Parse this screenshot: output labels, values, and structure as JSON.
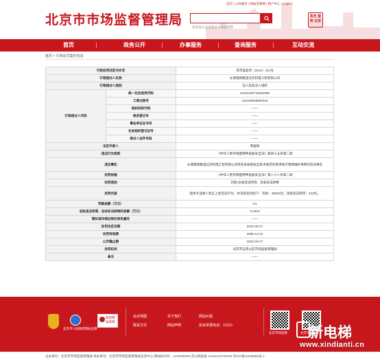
{
  "header": {
    "site_title": "北京市市场监督管理局",
    "top_links": "首页 | 公共服务 | 网站无障碍 | 用户中心 | English",
    "search_placeholder": "",
    "hot_words": "热点词 ● 企业登记 ● 食品经营",
    "badge_text": "政务 服务 北京",
    "brand_color": "#c8161d"
  },
  "nav": {
    "items": [
      "首页",
      "政务公开",
      "办事服务",
      "查询服务",
      "互动交流"
    ]
  },
  "breadcrumb": "首页 > 行政处罚案件信息",
  "table": {
    "doc_no_label": "行政处罚决定书文号",
    "doc_no": "京市监处罚〔2022〕341号",
    "party_name_label": "行政相对人名称",
    "party_name": "长城电梯集团北京机电工程有限公司",
    "party_type_label": "行政相对人类别",
    "party_type": "法人及非法人组织",
    "party_code_label": "行政相对人代码",
    "codes": [
      {
        "label": "统一社会信用代码",
        "value": "91110108749384985"
      },
      {
        "label": "工商注册号",
        "value": "110108005852044"
      },
      {
        "label": "组织机构代码",
        "value": "——"
      },
      {
        "label": "税务登记号",
        "value": "——"
      },
      {
        "label": "事业单位证书号",
        "value": "——"
      },
      {
        "label": "社会组织登记证号",
        "value": "——"
      },
      {
        "label": "相对人证件号码",
        "value": "——"
      }
    ],
    "legal_rep_label": "法定代表人",
    "legal_rep": "周金锋",
    "violation_type_label": "违法行为类型",
    "violation_type": "《中华人民共和国特种设备安全法》第四十五条第二款",
    "facts_label": "违法事实",
    "facts": "长城电梯集团北京机电工程有限公司存在未按照安全技术规范的要求进行电梯维护保养的违法事实",
    "basis_label": "处罚依据",
    "basis": "《中华人民共和国特种设备安全法》第八十八条第二款",
    "category_label": "处罚类别",
    "category": "罚款;没收违法所得、没收非法财物",
    "content_label": "处罚内容",
    "content": "现责令当事人改正上述违法行为，并决定处罚如下：罚款：35000元；没收违法所得：423元。",
    "fine_label": "罚款金额（万元）",
    "fine": "3.5",
    "confiscated_label": "没收违法所得、没收非法财物的金额（万元）",
    "confiscated": "0.0423",
    "suspend_label": "暂扣或吊销证照名称及编号",
    "suspend": "——",
    "decision_date_label": "处罚决定日期",
    "decision_date": "2022-06-27",
    "valid_until_label": "处罚有效期",
    "valid_until": "2099-12-31",
    "publicity_label": "公示截止期",
    "publicity": "2022-09-27",
    "authority_label": "处罚机关",
    "authority": "北京市石景山区市场监督管理局",
    "remark_label": "备注",
    "remark": "——"
  },
  "footer": {
    "org_badge": "北京市人民政府网站支撑",
    "errata": "政府网站找错",
    "links": [
      "站点地图",
      "关于我们",
      "联系方式",
      "网站声明",
      "网站纠错"
    ],
    "hotline": "投诉举报电话：12315",
    "qr1": "北京市场监管",
    "qr2": "北京市场监管",
    "bottom": "主办单位：北京市市场监督管理局  承办单位：北京市市场监督管理局信息中心  网站标识码：1100000065  京公网安备 11040102700026  京ICP备19039858号-1"
  },
  "watermark": {
    "brand": "新电梯",
    "url": "www.xindianti.cn"
  }
}
